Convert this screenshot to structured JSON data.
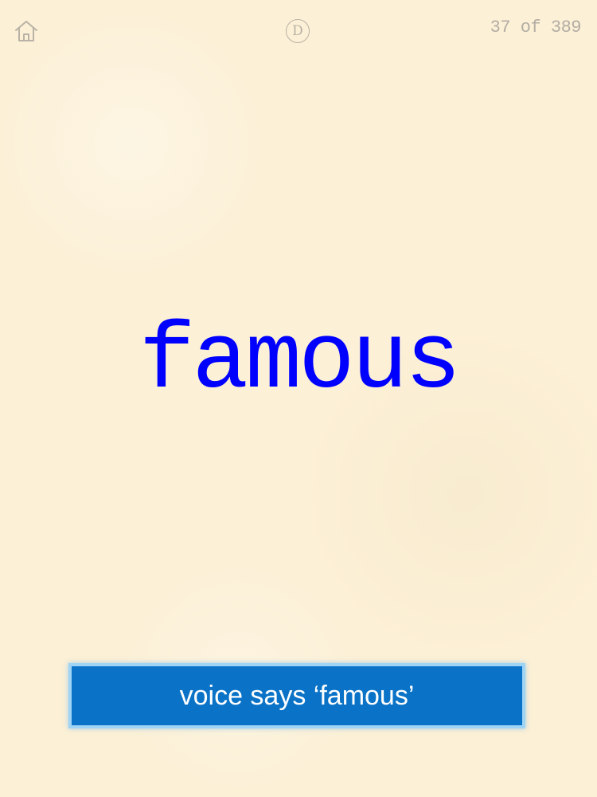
{
  "header": {
    "home_icon": "home-icon",
    "d_button_label": "D",
    "page_counter": "37 of 389"
  },
  "card": {
    "word": "famous"
  },
  "voice_button": {
    "label": "voice says ‘famous’"
  },
  "colors": {
    "background": "#fcf0d6",
    "word": "#0000ff",
    "button_fill": "#0a73c7",
    "button_border": "#9fd4f4",
    "header_gray": "#b3ada4"
  }
}
